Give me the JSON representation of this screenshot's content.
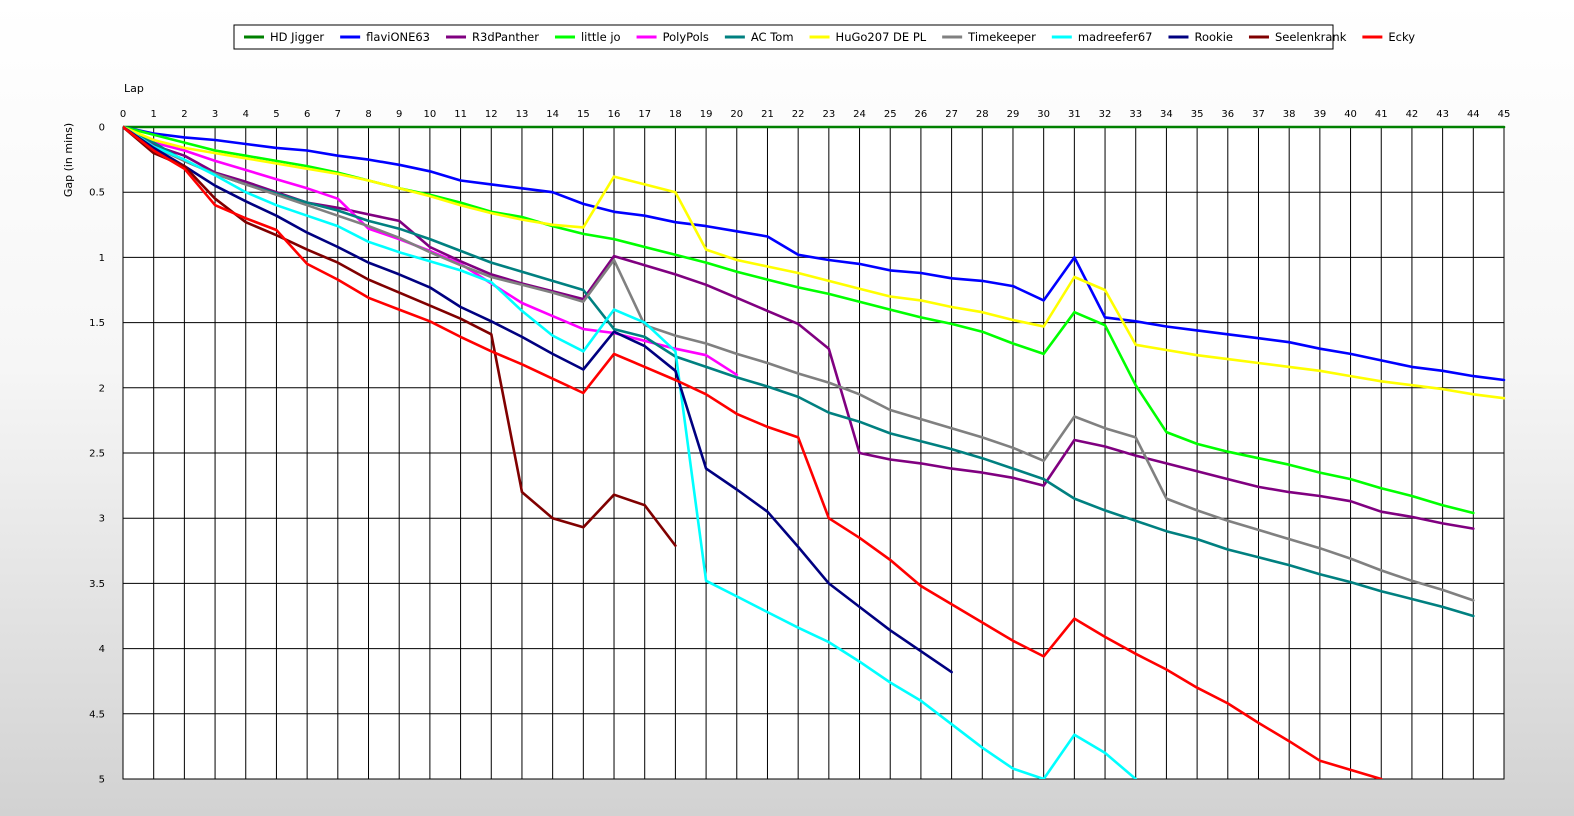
{
  "chart_data": {
    "type": "line",
    "xlabel": "Lap",
    "ylabel": "Gap (in mins)",
    "xlim": [
      0,
      45
    ],
    "ylim": [
      0,
      5
    ],
    "y_inverted": true,
    "grid": true,
    "legend_position": "top",
    "x_ticks": [
      0,
      1,
      2,
      3,
      4,
      5,
      6,
      7,
      8,
      9,
      10,
      11,
      12,
      13,
      14,
      15,
      16,
      17,
      18,
      19,
      20,
      21,
      22,
      23,
      24,
      25,
      26,
      27,
      28,
      29,
      30,
      31,
      32,
      33,
      34,
      35,
      36,
      37,
      38,
      39,
      40,
      41,
      42,
      43,
      44,
      45
    ],
    "y_ticks": [
      0,
      0.5,
      1,
      1.5,
      2,
      2.5,
      3,
      3.5,
      4,
      4.5,
      5
    ],
    "y_tick_labels": [
      "0",
      "0.5",
      "1",
      "1.5",
      "2",
      "2.5",
      "3",
      "3.5",
      "4",
      "4.5",
      "5"
    ],
    "series": [
      {
        "name": "HD Jigger",
        "color": "#008000",
        "values": [
          0,
          0,
          0,
          0,
          0,
          0,
          0,
          0,
          0,
          0,
          0,
          0,
          0,
          0,
          0,
          0,
          0,
          0,
          0,
          0,
          0,
          0,
          0,
          0,
          0,
          0,
          0,
          0,
          0,
          0,
          0,
          0,
          0,
          0,
          0,
          0,
          0,
          0,
          0,
          0,
          0,
          0,
          0,
          0,
          0,
          0
        ]
      },
      {
        "name": "flaviONE63",
        "color": "#0000FF",
        "values": [
          0,
          0.05,
          0.08,
          0.1,
          0.13,
          0.16,
          0.18,
          0.22,
          0.25,
          0.29,
          0.34,
          0.41,
          0.44,
          0.47,
          0.5,
          0.59,
          0.65,
          0.68,
          0.73,
          0.76,
          0.8,
          0.84,
          0.98,
          1.02,
          1.05,
          1.1,
          1.12,
          1.16,
          1.18,
          1.22,
          1.33,
          1.0,
          1.46,
          1.49,
          1.53,
          1.56,
          1.59,
          1.62,
          1.65,
          1.7,
          1.74,
          1.79,
          1.84,
          1.87,
          1.91,
          1.94
        ]
      },
      {
        "name": "R3dPanther",
        "color": "#800080",
        "values": [
          0,
          0.14,
          0.22,
          0.35,
          0.42,
          0.5,
          0.58,
          0.62,
          0.67,
          0.72,
          0.92,
          1.03,
          1.13,
          1.2,
          1.26,
          1.32,
          0.99,
          1.06,
          1.13,
          1.21,
          1.31,
          1.41,
          1.51,
          1.7,
          2.5,
          2.55,
          2.58,
          2.62,
          2.65,
          2.69,
          2.75,
          2.4,
          2.45,
          2.52,
          2.58,
          2.64,
          2.7,
          2.76,
          2.8,
          2.83,
          2.87,
          2.95,
          2.99,
          3.04,
          3.08
        ]
      },
      {
        "name": "little jo",
        "color": "#00FF00",
        "values": [
          0,
          0.06,
          0.12,
          0.18,
          0.22,
          0.26,
          0.3,
          0.35,
          0.41,
          0.47,
          0.52,
          0.58,
          0.65,
          0.69,
          0.76,
          0.82,
          0.86,
          0.92,
          0.98,
          1.04,
          1.11,
          1.17,
          1.23,
          1.28,
          1.34,
          1.4,
          1.46,
          1.51,
          1.57,
          1.66,
          1.74,
          1.42,
          1.52,
          1.98,
          2.34,
          2.43,
          2.49,
          2.54,
          2.59,
          2.65,
          2.7,
          2.77,
          2.83,
          2.9,
          2.96
        ]
      },
      {
        "name": "PolyPols",
        "color": "#FF00FF",
        "values": [
          0,
          0.12,
          0.18,
          0.26,
          0.33,
          0.4,
          0.47,
          0.55,
          0.78,
          0.86,
          0.95,
          1.05,
          1.2,
          1.35,
          1.45,
          1.55,
          1.58,
          1.64,
          1.7,
          1.75,
          1.9
        ]
      },
      {
        "name": "AC Tom",
        "color": "#008080",
        "values": [
          0,
          0.12,
          0.26,
          0.36,
          0.44,
          0.51,
          0.58,
          0.64,
          0.72,
          0.78,
          0.86,
          0.95,
          1.04,
          1.11,
          1.18,
          1.25,
          1.55,
          1.61,
          1.76,
          1.84,
          1.92,
          1.99,
          2.07,
          2.19,
          2.26,
          2.35,
          2.41,
          2.47,
          2.54,
          2.62,
          2.7,
          2.85,
          2.94,
          3.02,
          3.1,
          3.16,
          3.24,
          3.3,
          3.36,
          3.43,
          3.49,
          3.56,
          3.62,
          3.68,
          3.75
        ]
      },
      {
        "name": "HuGo207 DE PL",
        "color": "#FFFF00",
        "values": [
          0,
          0.1,
          0.16,
          0.2,
          0.24,
          0.28,
          0.32,
          0.36,
          0.41,
          0.47,
          0.53,
          0.6,
          0.66,
          0.71,
          0.75,
          0.77,
          0.38,
          0.44,
          0.5,
          0.94,
          1.02,
          1.07,
          1.12,
          1.18,
          1.24,
          1.3,
          1.33,
          1.38,
          1.42,
          1.48,
          1.53,
          1.15,
          1.25,
          1.67,
          1.71,
          1.75,
          1.78,
          1.81,
          1.84,
          1.87,
          1.91,
          1.95,
          1.98,
          2.01,
          2.05,
          2.08
        ]
      },
      {
        "name": "Timekeeper",
        "color": "#808080",
        "values": [
          0,
          0.15,
          0.26,
          0.36,
          0.44,
          0.52,
          0.6,
          0.68,
          0.76,
          0.85,
          0.96,
          1.06,
          1.15,
          1.21,
          1.27,
          1.34,
          1.02,
          1.52,
          1.6,
          1.66,
          1.74,
          1.81,
          1.89,
          1.96,
          2.05,
          2.17,
          2.24,
          2.31,
          2.38,
          2.46,
          2.56,
          2.22,
          2.31,
          2.38,
          2.85,
          2.94,
          3.02,
          3.09,
          3.16,
          3.23,
          3.31,
          3.4,
          3.48,
          3.55,
          3.63
        ]
      },
      {
        "name": "madreefer67",
        "color": "#00FFFF",
        "values": [
          0,
          0.15,
          0.25,
          0.37,
          0.5,
          0.6,
          0.68,
          0.76,
          0.88,
          0.96,
          1.03,
          1.1,
          1.19,
          1.41,
          1.6,
          1.72,
          1.4,
          1.5,
          1.72,
          3.48,
          3.6,
          3.72,
          3.84,
          3.95,
          4.1,
          4.26,
          4.4,
          4.58,
          4.76,
          4.92,
          5.0,
          4.66,
          4.8,
          5.0
        ]
      },
      {
        "name": "Rookie",
        "color": "#000080",
        "values": [
          0,
          0.16,
          0.3,
          0.45,
          0.57,
          0.68,
          0.81,
          0.92,
          1.04,
          1.13,
          1.23,
          1.38,
          1.49,
          1.61,
          1.74,
          1.86,
          1.57,
          1.68,
          1.87,
          2.62,
          2.78,
          2.95,
          3.22,
          3.5,
          3.68,
          3.86,
          4.02,
          4.18
        ]
      },
      {
        "name": "Seelenkrank",
        "color": "#800000",
        "values": [
          0,
          0.2,
          0.3,
          0.55,
          0.73,
          0.83,
          0.94,
          1.04,
          1.17,
          1.27,
          1.37,
          1.47,
          1.59,
          2.8,
          3.0,
          3.07,
          2.82,
          2.9,
          3.21
        ]
      },
      {
        "name": "Ecky",
        "color": "#FF0000",
        "values": [
          0,
          0.18,
          0.32,
          0.6,
          0.7,
          0.79,
          1.05,
          1.17,
          1.31,
          1.4,
          1.49,
          1.61,
          1.72,
          1.82,
          1.93,
          2.04,
          1.74,
          1.84,
          1.94,
          2.05,
          2.2,
          2.3,
          2.38,
          3.0,
          3.15,
          3.32,
          3.52,
          3.66,
          3.8,
          3.94,
          4.06,
          3.77,
          3.91,
          4.04,
          4.16,
          4.3,
          4.42,
          4.57,
          4.71,
          4.86,
          4.93,
          5.0
        ]
      }
    ]
  }
}
